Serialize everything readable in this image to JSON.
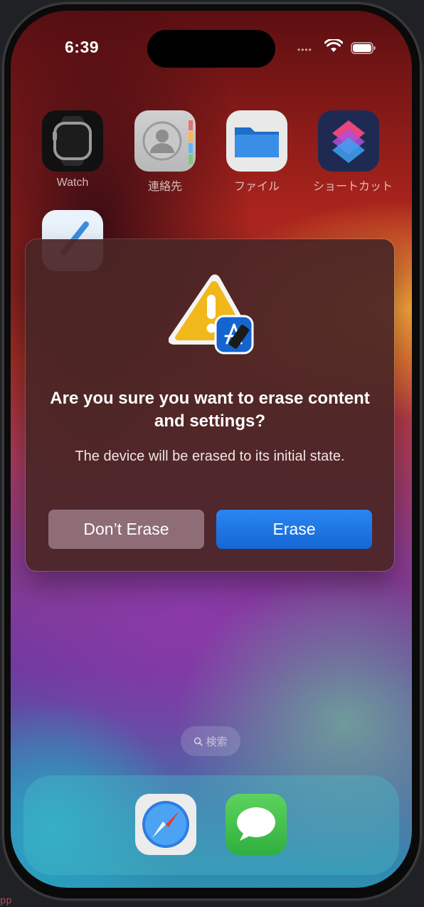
{
  "status_bar": {
    "time": "6:39",
    "signal_dots": "••••"
  },
  "apps": [
    {
      "label": "Watch",
      "icon": "watch-app-icon"
    },
    {
      "label": "連絡先",
      "icon": "contacts-app-icon"
    },
    {
      "label": "ファイル",
      "icon": "files-app-icon"
    },
    {
      "label": "ショートカット",
      "icon": "shortcuts-app-icon"
    }
  ],
  "partial_app": {
    "icon": "xcode-like-app-icon"
  },
  "dialog": {
    "title": "Are you sure you want to erase content and settings?",
    "message": "The device will be erased to its initial state.",
    "cancel_label": "Don’t Erase",
    "confirm_label": "Erase",
    "icon": "warning-with-appstore-icon"
  },
  "search": {
    "label": "検索",
    "icon": "search-icon"
  },
  "dock": [
    {
      "name": "Safari",
      "icon": "safari-icon"
    },
    {
      "name": "Messages",
      "icon": "messages-icon"
    }
  ],
  "colors": {
    "accent": "#1a73e8",
    "cancel": "#8e6d77",
    "dialog_bg": "#4a2626"
  },
  "background_fragment": "pp"
}
